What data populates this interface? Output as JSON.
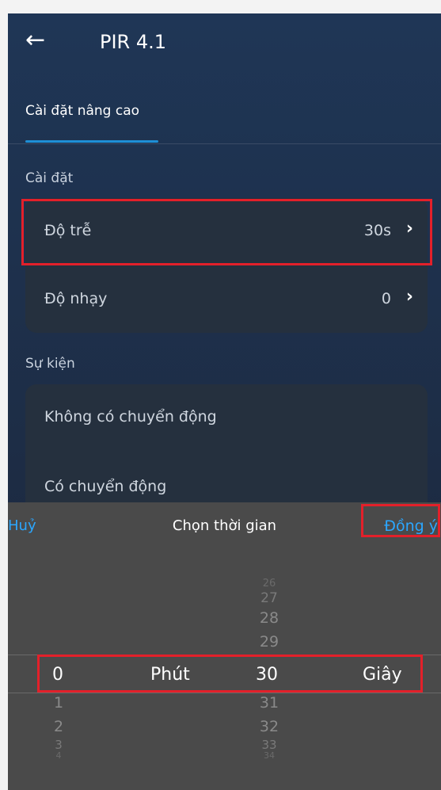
{
  "header": {
    "title": "PIR 4.1",
    "back_icon": "arrow-left-icon"
  },
  "tabs": {
    "active": "Cài đặt nâng cao"
  },
  "settings": {
    "section_label": "Cài đặt",
    "items": [
      {
        "label": "Độ trễ",
        "value": "30s"
      },
      {
        "label": "Độ nhạy",
        "value": "0"
      }
    ]
  },
  "events": {
    "section_label": "Sự kiện",
    "items": [
      {
        "label": "Không có chuyển động"
      },
      {
        "label": "Có chuyển động"
      }
    ]
  },
  "picker": {
    "cancel_label": "Huỷ",
    "title": "Chọn thời gian",
    "confirm_label": "Đồng ý",
    "minutes": {
      "selected": "0",
      "unit": "Phút",
      "after": [
        "1",
        "2",
        "3",
        "4"
      ]
    },
    "seconds": {
      "selected": "30",
      "unit": "Giây",
      "before": [
        "26",
        "27",
        "28",
        "29"
      ],
      "after": [
        "31",
        "32",
        "33",
        "34"
      ]
    }
  },
  "colors": {
    "accent": "#2ba7ff",
    "highlight": "#e3202a",
    "tab_indicator": "#1e8fd6"
  }
}
